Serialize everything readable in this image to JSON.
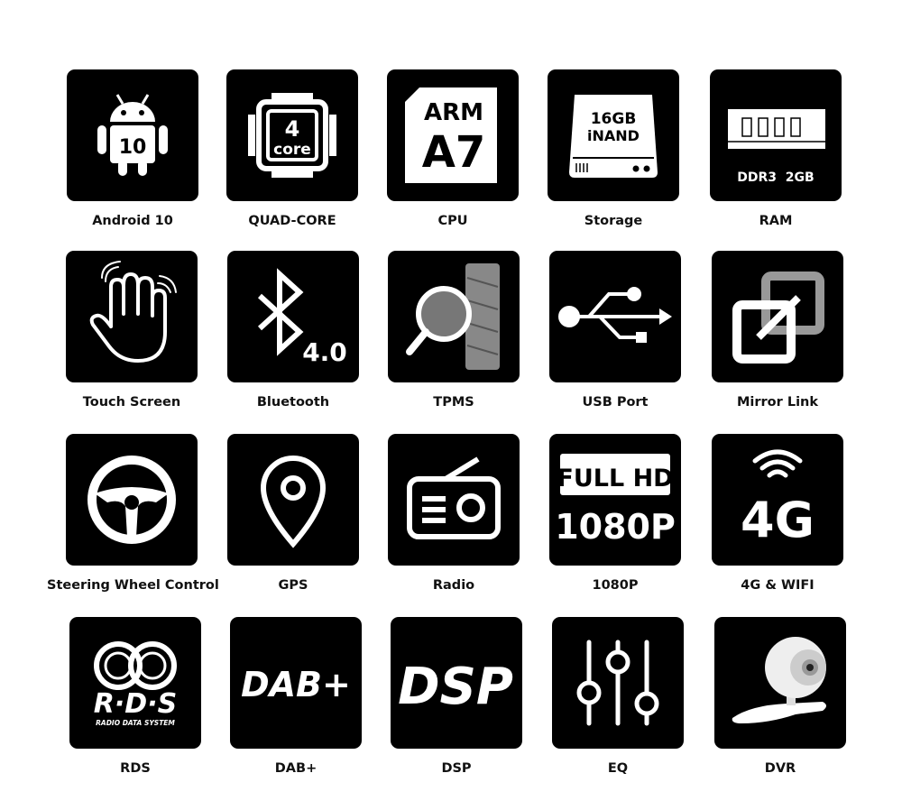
{
  "features": [
    {
      "label": "Android 10",
      "icon": "android-icon",
      "icon_text": "10"
    },
    {
      "label": "QUAD-CORE",
      "icon": "cpu-chip-icon",
      "icon_text": "4",
      "icon_subtext": "core"
    },
    {
      "label": "CPU",
      "icon": "arm-chip-icon",
      "icon_text": "ARM",
      "icon_subtext": "A7"
    },
    {
      "label": "Storage",
      "icon": "hard-drive-icon",
      "icon_text": "16GB",
      "icon_subtext": "iNAND"
    },
    {
      "label": "RAM",
      "icon": "memory-module-icon",
      "icon_text": "DDR3  2GB"
    },
    {
      "label": "Touch Screen",
      "icon": "hand-touch-icon"
    },
    {
      "label": "Bluetooth",
      "icon": "bluetooth-icon",
      "icon_text": "4.0"
    },
    {
      "label": "TPMS",
      "icon": "tire-magnifier-icon"
    },
    {
      "label": "USB Port",
      "icon": "usb-icon"
    },
    {
      "label": "Mirror Link",
      "icon": "mirror-link-icon"
    },
    {
      "label": "Steering Wheel Control",
      "icon": "steering-wheel-icon"
    },
    {
      "label": "GPS",
      "icon": "map-pin-icon"
    },
    {
      "label": "Radio",
      "icon": "radio-icon"
    },
    {
      "label": "1080P",
      "icon": "full-hd-icon",
      "icon_text": "FULL HD",
      "icon_subtext": "1080P"
    },
    {
      "label": "4G & WIFI",
      "icon": "4g-wifi-icon",
      "icon_text": "4G"
    },
    {
      "label": "RDS",
      "icon": "rds-logo-icon",
      "icon_text": "R·D·S",
      "icon_subtext": "RADIO DATA SYSTEM"
    },
    {
      "label": "DAB+",
      "icon": "dab-plus-icon",
      "icon_text": "DAB+"
    },
    {
      "label": "DSP",
      "icon": "dsp-icon",
      "icon_text": "DSP"
    },
    {
      "label": "EQ",
      "icon": "equalizer-icon"
    },
    {
      "label": "DVR",
      "icon": "dash-camera-icon"
    }
  ],
  "colors": {
    "tile": "#000000",
    "icon": "#ffffff",
    "label": "#111111"
  }
}
